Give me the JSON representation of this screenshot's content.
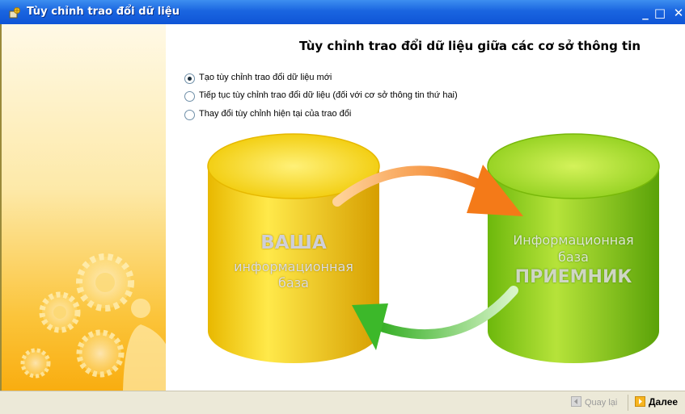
{
  "window": {
    "title": "Tùy chỉnh trao đổi dữ liệu",
    "minimize_label": "_",
    "maximize_label": "□",
    "close_label": "✕"
  },
  "main": {
    "heading": "Tùy chỉnh trao đổi dữ liệu giữa các cơ sở thông tin",
    "options": [
      {
        "label": "Tạo tùy chỉnh trao đổi dữ liệu mới",
        "checked": true
      },
      {
        "label": "Tiếp tục tùy chỉnh trao đổi dữ liệu (đối với cơ sở thông tin thứ hai)",
        "checked": false
      },
      {
        "label": "Thay đổi tùy chỉnh hiện tại của trao đổi",
        "checked": false
      }
    ]
  },
  "diagram": {
    "source_db": {
      "line1": "ВАША",
      "line2": "информационная",
      "line3": "база"
    },
    "target_db": {
      "line1": "Информационная",
      "line2": "база",
      "line3": "ПРИЕМНИК"
    }
  },
  "footer": {
    "back_label": "Quay lại",
    "next_label": "Далее"
  },
  "colors": {
    "titlebar": "#0f55d6",
    "source_db": "#f2d10a",
    "target_db": "#8ccd1a",
    "arrow_forward": "#f47a18",
    "arrow_back": "#3cb82a"
  },
  "icons": {
    "window": "settings-wizard-icon",
    "back": "arrow-left-icon",
    "next": "arrow-right-icon"
  }
}
